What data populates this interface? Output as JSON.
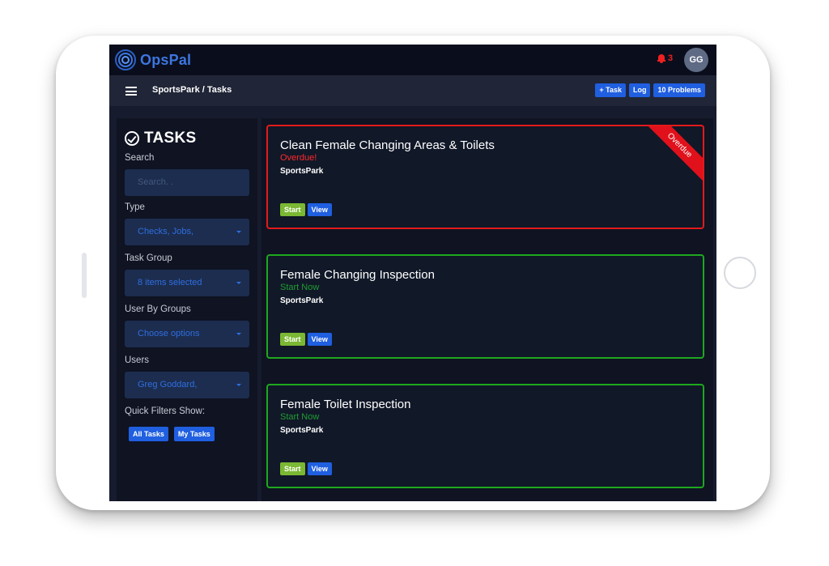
{
  "app": {
    "name": "OpsPal"
  },
  "header": {
    "notification_count": "3",
    "avatar_initials": "GG"
  },
  "subheader": {
    "breadcrumb": "SportsPark / Tasks",
    "actions": [
      {
        "label": "+ Task"
      },
      {
        "label": "Log"
      },
      {
        "label": "10 Problems"
      }
    ]
  },
  "sidebar": {
    "title": "TASKS",
    "search": {
      "label": "Search",
      "placeholder": "Search. ."
    },
    "type": {
      "label": "Type",
      "value": "Checks, Jobs,"
    },
    "task_group": {
      "label": "Task Group",
      "value": "8 items selected"
    },
    "user_groups": {
      "label": "User By Groups",
      "value": "Choose options"
    },
    "users": {
      "label": "Users",
      "value": "Greg Goddard,"
    },
    "quick_filters": {
      "label": "Quick Filters Show:",
      "buttons": [
        {
          "label": "All Tasks"
        },
        {
          "label": "My Tasks"
        }
      ]
    }
  },
  "tasks": [
    {
      "title": "Clean Female Changing Areas & Toilets",
      "status": "Overdue!",
      "site": "SportsPark",
      "ribbon": "Overdue",
      "start_label": "Start",
      "view_label": "View"
    },
    {
      "title": "Female Changing Inspection",
      "status": "Start Now",
      "site": "SportsPark",
      "start_label": "Start",
      "view_label": "View"
    },
    {
      "title": "Female Toilet Inspection",
      "status": "Start Now",
      "site": "SportsPark",
      "start_label": "Start",
      "view_label": "View"
    }
  ],
  "colors": {
    "accent": "#1f5fe0",
    "overdue": "#e31a1a",
    "ok": "#1ea81e",
    "start_button": "#7bb833",
    "background": "#171b2e"
  }
}
